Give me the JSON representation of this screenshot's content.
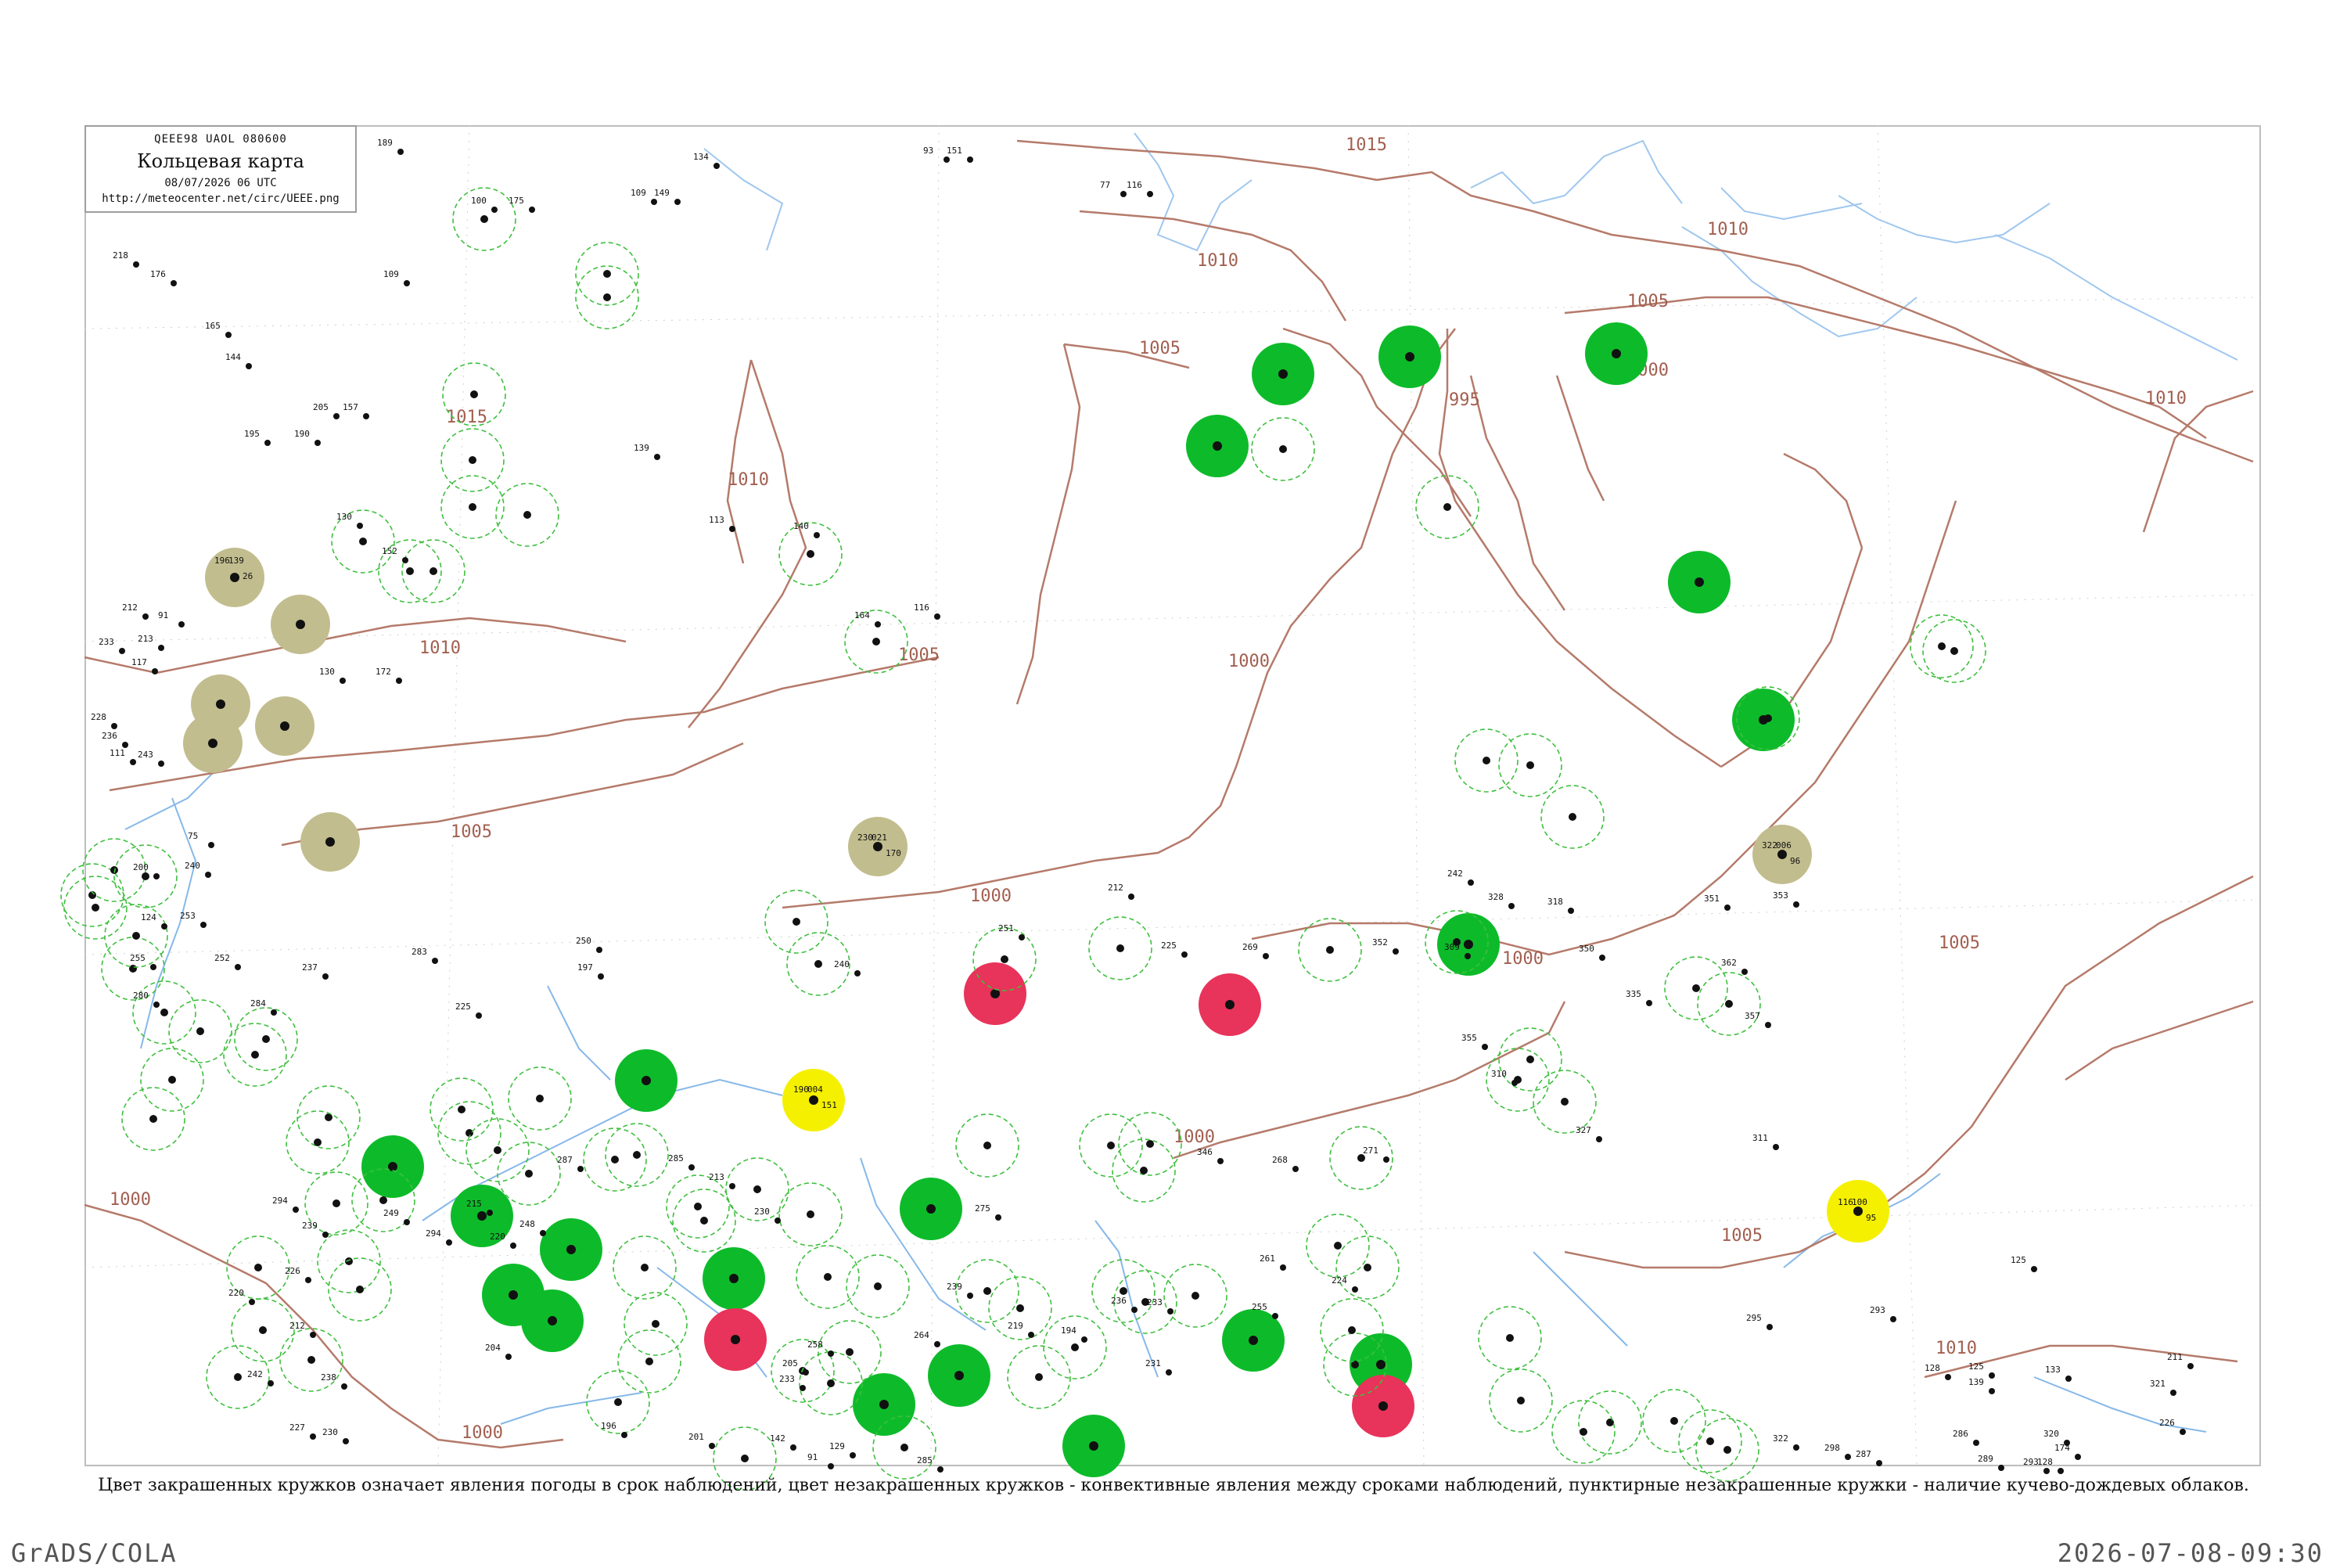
{
  "header": {
    "code_line": "QEEE98  UAOL  080600",
    "title": "Кольцевая карта",
    "date_line": "08/07/2026 06 UTC",
    "url": "http://meteocenter.net/circ/UEEE.png"
  },
  "footer": {
    "note": "Цвет закрашенных кружков означает явления погоды в срок наблюдений, цвет незакрашенных кружков - конвективные явления между сроками наблюдений, пунктирные незакрашенные кружки - наличие кучево-дождевых облаков.",
    "software": "GrADS/COLA",
    "timestamp": "2026-07-08-09:30"
  },
  "colors": {
    "isobar": "#b57a6a",
    "river": "#86b8e8",
    "rain_fill": "#0dbb2a",
    "thunder_fill": "#e8335a",
    "fog_fill": "#c2bd8e",
    "drizzle_fill": "#f5f000",
    "cb_ring": "#3fbf3f"
  },
  "isobars": [
    {
      "value": "1015"
    },
    {
      "value": "1010"
    },
    {
      "value": "1005"
    },
    {
      "value": "1000"
    },
    {
      "value": "995"
    }
  ],
  "stations": [
    {
      "fill": "rain",
      "ring": true,
      "t": "",
      "p": "",
      "d": ""
    },
    {
      "fill": "thunder",
      "ring": true,
      "t": "",
      "p": "",
      "d": ""
    },
    {
      "fill": "fog",
      "ring": false,
      "t": "196",
      "p": "139",
      "d": "26"
    },
    {
      "fill": "drizzle",
      "ring": false,
      "t": "190",
      "p": "004",
      "d": "151"
    },
    {
      "fill": "drizzle",
      "ring": false,
      "t": "116",
      "p": "100",
      "d": "95"
    },
    {
      "fill": "fog",
      "ring": false,
      "t": "230",
      "p": "021",
      "d": "170"
    },
    {
      "fill": "fog",
      "ring": false,
      "t": "322",
      "p": "006",
      "d": "96"
    }
  ],
  "visible_station_labels": {
    "temp_samples": [
      "189",
      "100",
      "175",
      "109",
      "149",
      "134",
      "93",
      "151",
      "77",
      "116",
      "218",
      "176",
      "109",
      "165",
      "144",
      "205",
      "157",
      "195",
      "190",
      "139",
      "113",
      "140",
      "130",
      "152",
      "164",
      "116",
      "130",
      "172",
      "212",
      "91",
      "213",
      "233",
      "117",
      "228",
      "236",
      "111",
      "243",
      "75",
      "200",
      "240",
      "124",
      "253",
      "252",
      "255",
      "280",
      "284",
      "237",
      "283",
      "225",
      "197",
      "250",
      "240",
      "251",
      "212",
      "225",
      "269",
      "242",
      "309",
      "352",
      "328",
      "318",
      "351",
      "353",
      "350",
      "362",
      "335",
      "357",
      "355",
      "310",
      "327",
      "311",
      "346",
      "268",
      "271",
      "261",
      "255",
      "224",
      "233",
      "236",
      "231",
      "219",
      "194",
      "275",
      "239",
      "264",
      "258",
      "205",
      "233",
      "230",
      "213",
      "285",
      "287",
      "248",
      "220",
      "215",
      "294",
      "249",
      "239",
      "294",
      "226",
      "220",
      "212",
      "238",
      "242",
      "227",
      "230",
      "204",
      "196",
      "201",
      "142",
      "129",
      "91",
      "285",
      "125",
      "128",
      "125",
      "139",
      "133",
      "321",
      "211",
      "226",
      "320",
      "174",
      "128",
      "293",
      "289",
      "286",
      "287",
      "298",
      "295",
      "293",
      "322",
      "247"
    ]
  }
}
